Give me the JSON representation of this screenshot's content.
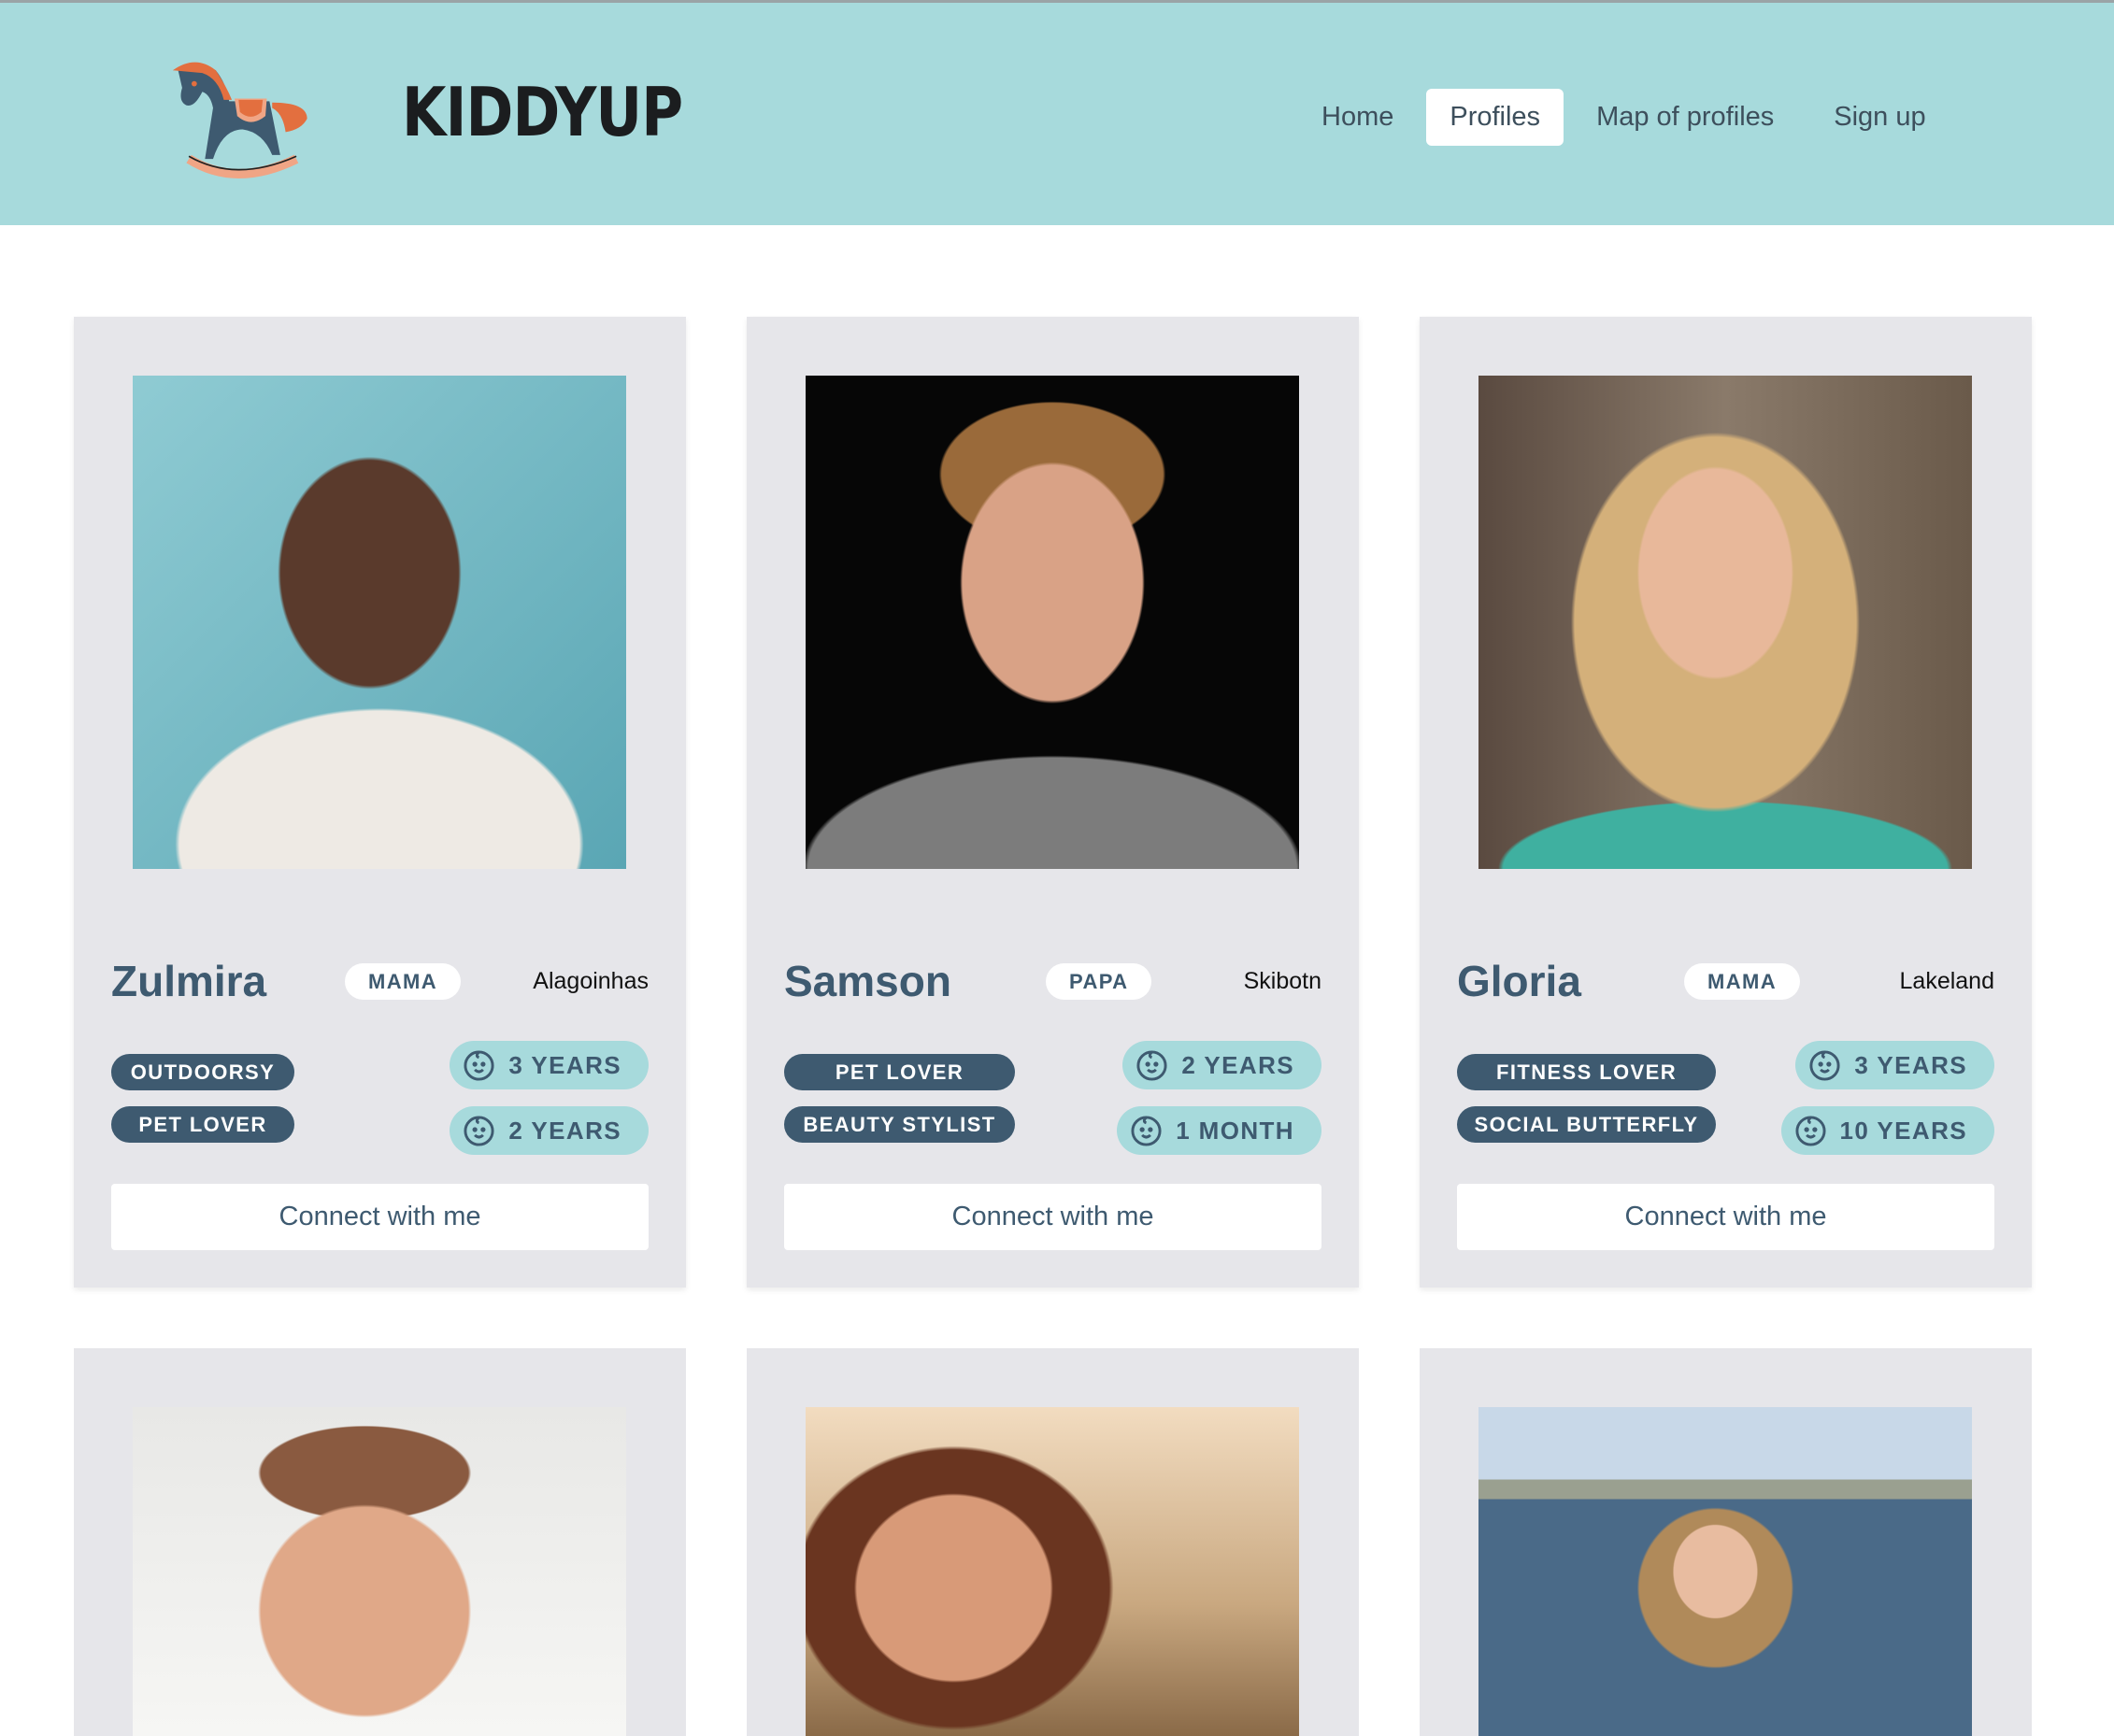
{
  "header": {
    "logo_text": "KIDDYUP",
    "nav": [
      {
        "label": "Home",
        "active": false
      },
      {
        "label": "Profiles",
        "active": true
      },
      {
        "label": "Map of profiles",
        "active": false
      },
      {
        "label": "Sign up",
        "active": false
      }
    ]
  },
  "colors": {
    "header_bg": "#a7dadc",
    "card_bg": "#e6e6ea",
    "primary": "#3e5a70",
    "accent": "#e36f3f"
  },
  "profiles": [
    {
      "name": "Zulmira",
      "role": "MAMA",
      "location": "Alagoinhas",
      "tags": [
        "OUTDOORSY",
        "PET LOVER"
      ],
      "ages": [
        "3 YEARS",
        "2 YEARS"
      ],
      "button": "Connect with me"
    },
    {
      "name": "Samson",
      "role": "PAPA",
      "location": "Skibotn",
      "tags": [
        "PET LOVER",
        "BEAUTY STYLIST"
      ],
      "ages": [
        "2 YEARS",
        "1 MONTH"
      ],
      "button": "Connect with me"
    },
    {
      "name": "Gloria",
      "role": "MAMA",
      "location": "Lakeland",
      "tags": [
        "FITNESS LOVER",
        "SOCIAL BUTTERFLY"
      ],
      "ages": [
        "3 YEARS",
        "10 YEARS"
      ],
      "button": "Connect with me"
    }
  ]
}
